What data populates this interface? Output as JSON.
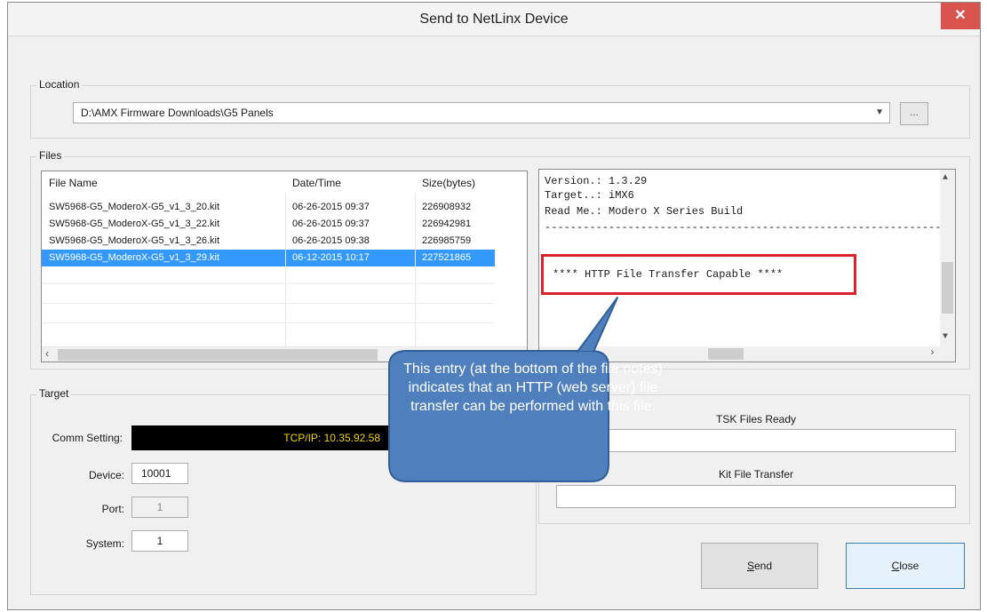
{
  "window": {
    "title": "Send to NetLinx Device",
    "close_glyph": "✕"
  },
  "location": {
    "group_label": "Location",
    "path": "D:\\AMX Firmware Downloads\\G5 Panels",
    "browse_label": "..."
  },
  "files": {
    "group_label": "Files",
    "columns": [
      "File Name",
      "Date/Time",
      "Size(bytes)"
    ],
    "rows": [
      {
        "name": "SW5968-G5_ModeroX-G5_v1_3_20.kit",
        "datetime": "06-26-2015  09:37",
        "size": "226908932",
        "selected": false
      },
      {
        "name": "SW5968-G5_ModeroX-G5_v1_3_22.kit",
        "datetime": "06-26-2015  09:37",
        "size": "226942981",
        "selected": false
      },
      {
        "name": "SW5968-G5_ModeroX-G5_v1_3_26.kit",
        "datetime": "06-26-2015  09:38",
        "size": "226985759",
        "selected": false
      },
      {
        "name": "SW5968-G5_ModeroX-G5_v1_3_29.kit",
        "datetime": "06-12-2015  10:17",
        "size": "227521865",
        "selected": true
      }
    ]
  },
  "notes": {
    "lines": [
      "Version.: 1.3.29",
      "Target..: iMX6",
      "Read Me.: Modero X Series Build",
      "----------------------------------------------------------------"
    ],
    "highlight": "**** HTTP File Transfer Capable ****"
  },
  "target": {
    "group_label": "Target",
    "comm_label": "Comm Setting:",
    "comm_value": "TCP/IP: 10.35.92.58",
    "device_label": "Device:",
    "device_value": "10001",
    "port_label": "Port:",
    "port_value": "1",
    "system_label": "System:",
    "system_value": "1"
  },
  "status": {
    "tsk_label": "TSK Files Ready",
    "kit_label": "Kit File Transfer"
  },
  "buttons": {
    "send_hotkey": "S",
    "send_rest": "end",
    "close_hotkey": "C",
    "close_rest": "lose"
  },
  "callout": {
    "text": "This entry (at the bottom of the file notes) indicates that an HTTP (web server) file transfer can be performed with this file."
  },
  "colors": {
    "selection": "#3399ff",
    "comm_bg": "#000000",
    "comm_text": "#f0d200",
    "highlight_border": "#d8232a",
    "callout_fill": "#4f7fbd",
    "close_button": "#d9534f"
  }
}
